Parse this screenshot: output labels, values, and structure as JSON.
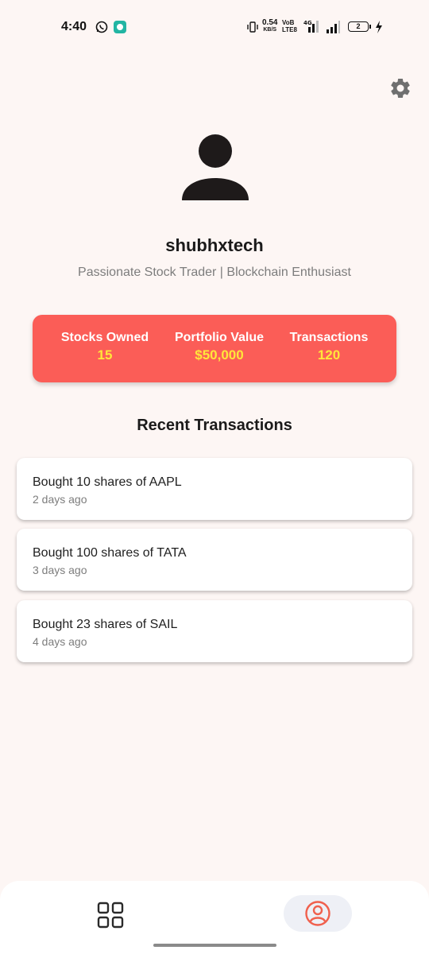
{
  "status_bar": {
    "time": "4:40",
    "net_speed": "0.54",
    "net_unit": "KB/S",
    "volte": "VoB LTE8",
    "battery": "2"
  },
  "profile": {
    "username": "shubhxtech",
    "bio": "Passionate Stock Trader | Blockchain Enthusiast"
  },
  "stats": [
    {
      "label": "Stocks Owned",
      "value": "15"
    },
    {
      "label": "Portfolio Value",
      "value": "$50,000"
    },
    {
      "label": "Transactions",
      "value": "120"
    }
  ],
  "recent": {
    "title": "Recent Transactions",
    "items": [
      {
        "title": "Bought 10 shares of AAPL",
        "time": "2 days ago"
      },
      {
        "title": "Bought 100 shares of TATA",
        "time": "3 days ago"
      },
      {
        "title": "Bought 23 shares of SAIL",
        "time": "4 days ago"
      }
    ]
  },
  "nav": {
    "items": [
      {
        "icon": "grid-icon",
        "active": false
      },
      {
        "icon": "profile-icon",
        "active": true
      }
    ]
  },
  "colors": {
    "background": "#fdf6f4",
    "stats_card": "#fb5d57",
    "stat_value": "#ffe63a",
    "nav_accent": "#f0604d"
  }
}
